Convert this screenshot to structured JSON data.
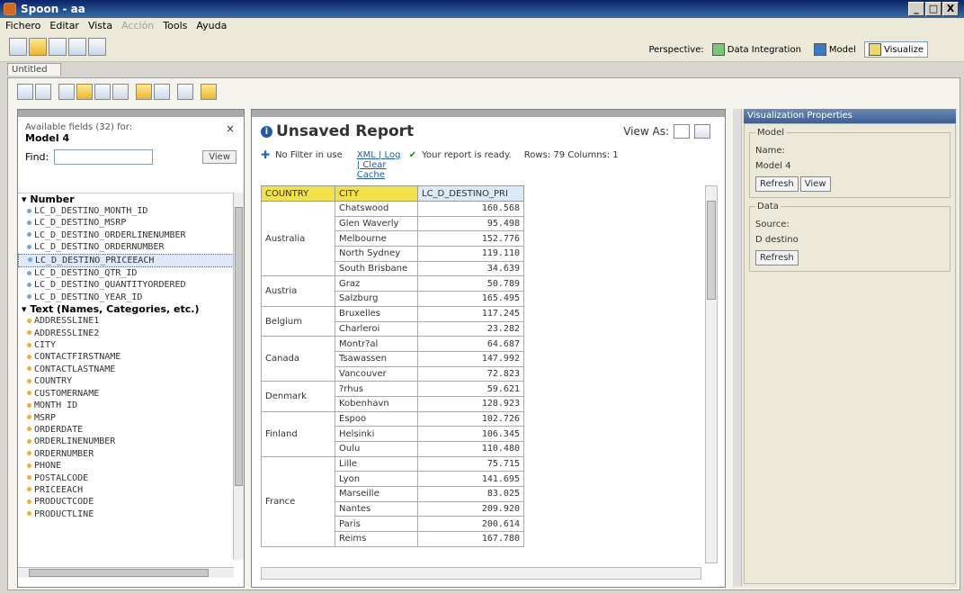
{
  "window": {
    "title": "Spoon - aa",
    "controls": [
      "_",
      "□",
      "X"
    ]
  },
  "menu": [
    {
      "label": "Fichero",
      "enabled": true
    },
    {
      "label": "Editar",
      "enabled": true
    },
    {
      "label": "Vista",
      "enabled": true
    },
    {
      "label": "Acción",
      "enabled": false
    },
    {
      "label": "Tools",
      "enabled": true
    },
    {
      "label": "Ayuda",
      "enabled": true
    }
  ],
  "perspective": {
    "label": "Perspective:",
    "options": [
      "Data Integration",
      "Model",
      "Visualize"
    ],
    "active": "Visualize"
  },
  "tab": {
    "label": "Untitled"
  },
  "left_panel": {
    "available": "Available fields (32) for:",
    "model": "Model 4",
    "find_label": "Find:",
    "view_label": "View",
    "close": "×",
    "number_group": "Number",
    "number_fields": [
      "LC_D_DESTINO_MONTH_ID",
      "LC_D_DESTINO_MSRP",
      "LC_D_DESTINO_ORDERLINENUMBER",
      "LC_D_DESTINO_ORDERNUMBER",
      "LC_D_DESTINO_PRICEEACH",
      "LC_D_DESTINO_QTR_ID",
      "LC_D_DESTINO_QUANTITYORDERED",
      "LC_D_DESTINO_YEAR_ID"
    ],
    "selected_field": "LC_D_DESTINO_PRICEEACH",
    "text_group": "Text (Names, Categories, etc.)",
    "text_fields": [
      "ADDRESSLINE1",
      "ADDRESSLINE2",
      "CITY",
      "CONTACTFIRSTNAME",
      "CONTACTLASTNAME",
      "COUNTRY",
      "CUSTOMERNAME",
      "MONTH ID",
      "MSRP",
      "ORDERDATE",
      "ORDERLINENUMBER",
      "ORDERNUMBER",
      "PHONE",
      "POSTALCODE",
      "PRICEEACH",
      "PRODUCTCODE",
      "PRODUCTLINE"
    ]
  },
  "report": {
    "title": "Unsaved Report",
    "view_as": "View As:",
    "filter": "No Filter in use",
    "links": "XML | Log | Clear Cache",
    "ready": "Your report is ready.",
    "rows_cols": "Rows: 79  Columns: 1",
    "headers": [
      "COUNTRY",
      "CITY",
      "LC_D_DESTINO_PRI"
    ],
    "groups": [
      {
        "country": "Australia",
        "rows": [
          [
            "Chatswood",
            "160.568"
          ],
          [
            "Glen Waverly",
            "95.498"
          ],
          [
            "Melbourne",
            "152.776"
          ],
          [
            "North Sydney",
            "119.110"
          ],
          [
            "South Brisbane",
            "34.639"
          ]
        ]
      },
      {
        "country": "Austria",
        "rows": [
          [
            "Graz",
            "50.789"
          ],
          [
            "Salzburg",
            "165.495"
          ]
        ]
      },
      {
        "country": "Belgium",
        "rows": [
          [
            "Bruxelles",
            "117.245"
          ],
          [
            "Charleroi",
            "23.282"
          ]
        ]
      },
      {
        "country": "Canada",
        "rows": [
          [
            "Montr?al",
            "64.687"
          ],
          [
            "Tsawassen",
            "147.992"
          ],
          [
            "Vancouver",
            "72.823"
          ]
        ]
      },
      {
        "country": "Denmark",
        "rows": [
          [
            "?rhus",
            "59.621"
          ],
          [
            "Kobenhavn",
            "128.923"
          ]
        ]
      },
      {
        "country": "Finland",
        "rows": [
          [
            "Espoo",
            "102.726"
          ],
          [
            "Helsinki",
            "106.345"
          ],
          [
            "Oulu",
            "110.480"
          ]
        ]
      },
      {
        "country": "France",
        "rows": [
          [
            "Lille",
            "75.715"
          ],
          [
            "Lyon",
            "141.695"
          ],
          [
            "Marseille",
            "83.025"
          ],
          [
            "Nantes",
            "209.920"
          ],
          [
            "Paris",
            "200.614"
          ],
          [
            "Reims",
            "167.780"
          ]
        ]
      }
    ]
  },
  "props": {
    "title": "Visualization Properties",
    "model_legend": "Model",
    "name_label": "Name:",
    "name_value": "Model 4",
    "refresh": "Refresh",
    "view": "View",
    "data_legend": "Data",
    "source_label": "Source:",
    "source_value": "D destino"
  },
  "colors": {
    "header_yellow": "#f2e24a",
    "link_blue": "#1e5aa8",
    "ok_green": "#0a9a0a"
  }
}
